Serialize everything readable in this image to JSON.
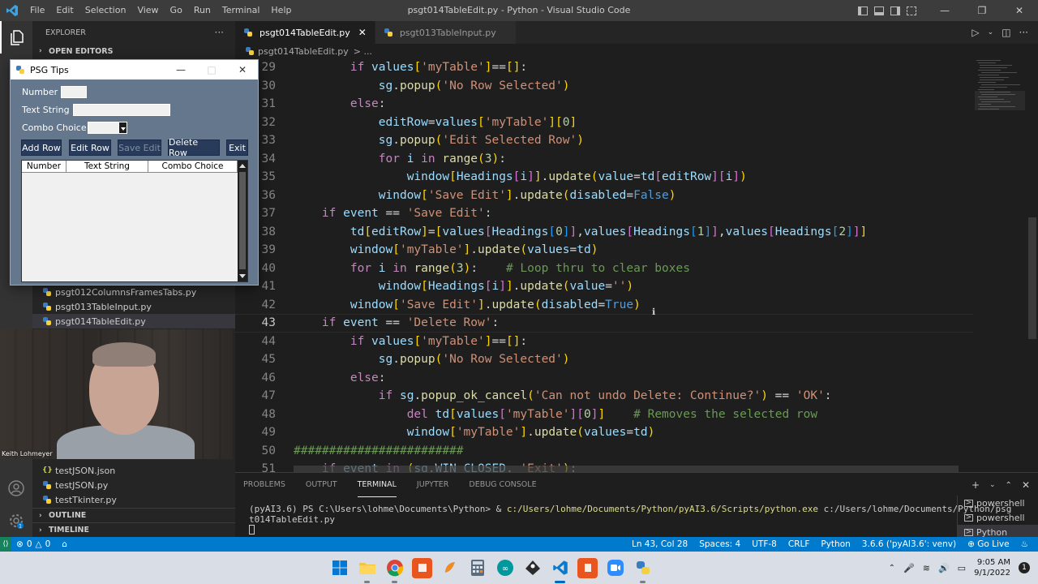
{
  "window": {
    "title": "psgt014TableEdit.py - Python - Visual Studio Code",
    "menu": [
      "File",
      "Edit",
      "Selection",
      "View",
      "Go",
      "Run",
      "Terminal",
      "Help"
    ]
  },
  "sidebar": {
    "header": "EXPLORER",
    "more": "···",
    "open_editors": "OPEN EDITORS",
    "files_upper": [
      "psgt012ColumnsFramesTabs.py",
      "psgt013TableInput.py",
      "psgt014TableEdit.py"
    ],
    "files_lower": [
      "testJSON.json",
      "testJSON.py",
      "testTkinter.py"
    ],
    "outline": "OUTLINE",
    "timeline": "TIMELINE"
  },
  "webcam": {
    "name": "Keith Lohmeyer"
  },
  "psg_window": {
    "title": "PSG Tips",
    "labels": {
      "number": "Number",
      "text_string": "Text String",
      "combo_choice": "Combo Choice"
    },
    "buttons": [
      "Add Row",
      "Edit Row",
      "Save Edit",
      "Delete Row",
      "Exit"
    ],
    "table_headers": [
      "Number",
      "Text String",
      "Combo Choice"
    ]
  },
  "tabs": [
    {
      "label": "psgt014TableEdit.py",
      "active": true
    },
    {
      "label": "psgt013TableInput.py",
      "active": false
    }
  ],
  "breadcrumb": {
    "file": "psgt014TableEdit.py",
    "rest": "> ..."
  },
  "code_lines": [
    {
      "n": "29",
      "text": "        if values['myTable']==[]:"
    },
    {
      "n": "30",
      "text": "            sg.popup('No Row Selected')"
    },
    {
      "n": "31",
      "text": "        else:"
    },
    {
      "n": "32",
      "text": "            editRow=values['myTable'][0]"
    },
    {
      "n": "33",
      "text": "            sg.popup('Edit Selected Row')"
    },
    {
      "n": "34",
      "text": "            for i in range(3):"
    },
    {
      "n": "35",
      "text": "                window[Headings[i]].update(value=td[editRow][i])"
    },
    {
      "n": "36",
      "text": "            window['Save Edit'].update(disabled=False)"
    },
    {
      "n": "37",
      "text": "    if event == 'Save Edit':"
    },
    {
      "n": "38",
      "text": "        td[editRow]=[values[Headings[0]],values[Headings[1]],values[Headings[2]]]"
    },
    {
      "n": "39",
      "text": "        window['myTable'].update(values=td)"
    },
    {
      "n": "40",
      "text": "        for i in range(3):    # Loop thru to clear boxes"
    },
    {
      "n": "41",
      "text": "            window[Headings[i]].update(value='')"
    },
    {
      "n": "42",
      "text": "        window['Save Edit'].update(disabled=True)"
    },
    {
      "n": "43",
      "text": "    if event == 'Delete Row':"
    },
    {
      "n": "44",
      "text": "        if values['myTable']==[]:"
    },
    {
      "n": "45",
      "text": "            sg.popup('No Row Selected')"
    },
    {
      "n": "46",
      "text": "        else:"
    },
    {
      "n": "47",
      "text": "            if sg.popup_ok_cancel('Can not undo Delete: Continue?') == 'OK':"
    },
    {
      "n": "48",
      "text": "                del td[values['myTable'][0]]    # Removes the selected row"
    },
    {
      "n": "49",
      "text": "                window['myTable'].update(values=td)"
    },
    {
      "n": "50",
      "text": "########################"
    },
    {
      "n": "51",
      "text": "    if event in (sg.WIN_CLOSED, 'Exit'):"
    }
  ],
  "panel": {
    "tabs": [
      "PROBLEMS",
      "OUTPUT",
      "TERMINAL",
      "JUPYTER",
      "DEBUG CONSOLE"
    ],
    "active_tab": "TERMINAL",
    "terminal_prompt": "(pyAI3.6) PS C:\\Users\\lohme\\Documents\\Python> & ",
    "terminal_cmd": "c:/Users/lohme/Documents/Python/pyAI3.6/Scripts/python.exe",
    "terminal_arg1": " c:/Users/lohme/Documents/Python/psg",
    "terminal_line2": "t014TableEdit.py",
    "terminal_list": [
      "powershell",
      "powershell",
      "Python"
    ]
  },
  "status": {
    "errors": "0",
    "warnings": "0",
    "position": "Ln 43, Col 28",
    "spaces": "Spaces: 4",
    "encoding": "UTF-8",
    "eol": "CRLF",
    "language": "Python",
    "interpreter": "3.6.6 ('pyAI3.6': venv)",
    "golive": "Go Live"
  },
  "taskbar": {
    "time": "9:05 AM",
    "date": "9/1/2022"
  },
  "colors": {
    "keyword": "#c586c0",
    "control": "#c586c0",
    "string": "#ce9178",
    "function": "#dcdcaa",
    "variable": "#9cdcfe",
    "number": "#b5cea8",
    "constant": "#569cd6",
    "comment": "#6a9955",
    "bracket1": "#ffd700",
    "bracket2": "#da70d6",
    "bracket3": "#179fff",
    "status_blue": "#007acc"
  }
}
